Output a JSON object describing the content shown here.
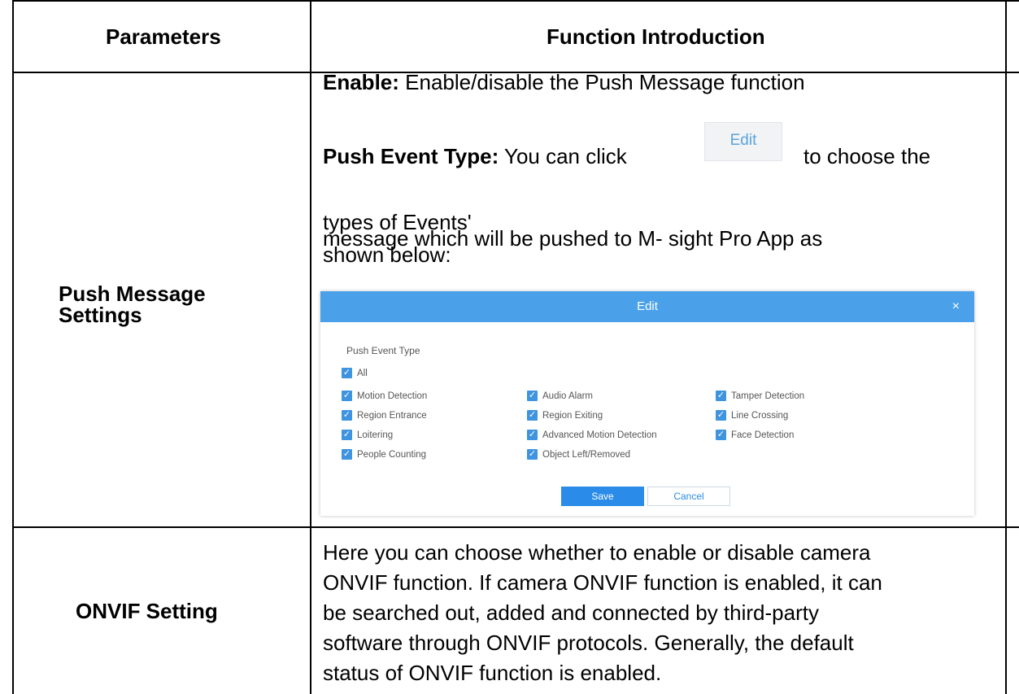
{
  "headers": {
    "parameters": "Parameters",
    "function_intro": "Function Introduction"
  },
  "rows": {
    "push_message": {
      "param": "Push Message Settings",
      "enable_label": "Enable:",
      "enable_text": "Enable/disable the Push Message function",
      "push_type_label": "Push Event Type:",
      "push_type_text_a": "You can click",
      "edit_button": "Edit",
      "push_type_text_b": "to choose the",
      "line3": "types of Events'",
      "line4": "message which will be pushed to M- sight Pro App as",
      "line5": "shown below:"
    },
    "onvif": {
      "param": "ONVIF Setting",
      "lines": [
        "Here you can choose whether to enable or disable camera",
        "ONVIF function. If camera ONVIF function is enabled, it can",
        "be searched out, added and connected by third-party",
        "software through ONVIF protocols. Generally, the default",
        "status of ONVIF function is enabled."
      ]
    }
  },
  "dialog": {
    "title": "Edit",
    "close": "×",
    "section": "Push Event Type",
    "all": "All",
    "options": {
      "col1": [
        "Motion Detection",
        "Region Entrance",
        "Loitering",
        "People Counting"
      ],
      "col2": [
        "Audio Alarm",
        "Region Exiting",
        "Advanced Motion Detection",
        "Object Left/Removed"
      ],
      "col3": [
        "Tamper Detection",
        "Line Crossing",
        "Face Detection"
      ]
    },
    "save": "Save",
    "cancel": "Cancel"
  },
  "colors": {
    "dialog_header": "#4aa1ea",
    "checkbox": "#3f94df",
    "save_button": "#2a8ce8"
  }
}
